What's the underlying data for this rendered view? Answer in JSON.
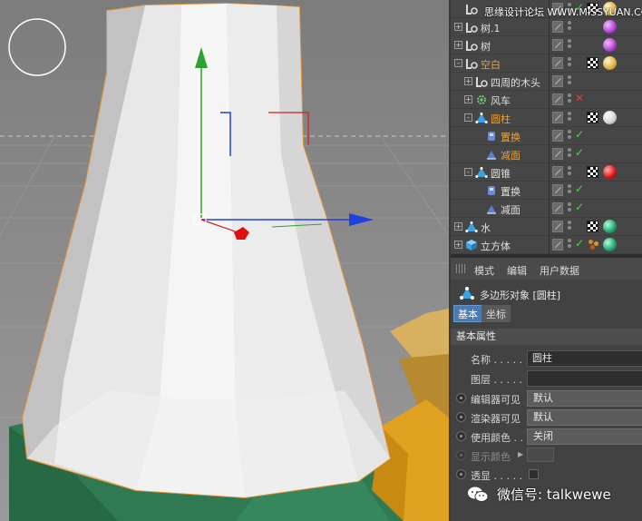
{
  "object_tree": [
    {
      "label": "",
      "icon": "null-object-icon",
      "indent": 0,
      "expand": "",
      "label_color": "normal",
      "state": "ok",
      "tag": "sphere-yellow"
    },
    {
      "label": "树.1",
      "icon": "null-object-icon",
      "indent": 0,
      "expand": "+",
      "label_color": "normal",
      "state": "",
      "tag": "sphere-purple"
    },
    {
      "label": "树",
      "icon": "null-object-icon",
      "indent": 0,
      "expand": "+",
      "label_color": "normal",
      "state": "",
      "tag": "sphere-purple"
    },
    {
      "label": "空白",
      "icon": "null-object-icon",
      "indent": 0,
      "expand": "-",
      "label_color": "orange",
      "state": "",
      "tag": "sphere-yellow"
    },
    {
      "label": "四周的木头",
      "icon": "null-object-icon",
      "indent": 1,
      "expand": "+",
      "label_color": "normal",
      "state": "",
      "tag": ""
    },
    {
      "label": "风车",
      "icon": "gear-icon",
      "indent": 1,
      "expand": "+",
      "label_color": "normal",
      "state": "x",
      "tag": ""
    },
    {
      "label": "圆柱",
      "icon": "polygon-icon",
      "indent": 1,
      "expand": "-",
      "label_color": "orange",
      "state": "",
      "tag": "sphere-white"
    },
    {
      "label": "置换",
      "icon": "displace-icon",
      "indent": 2,
      "expand": "",
      "label_color": "orange",
      "state": "ok",
      "tag": ""
    },
    {
      "label": "减面",
      "icon": "reduce-icon",
      "indent": 2,
      "expand": "",
      "label_color": "orange",
      "state": "ok",
      "tag": ""
    },
    {
      "label": "圆锥",
      "icon": "polygon-icon",
      "indent": 1,
      "expand": "-",
      "label_color": "normal",
      "state": "",
      "tag": "sphere-red"
    },
    {
      "label": "置换",
      "icon": "displace-icon",
      "indent": 2,
      "expand": "",
      "label_color": "normal",
      "state": "ok",
      "tag": ""
    },
    {
      "label": "减面",
      "icon": "reduce-icon",
      "indent": 2,
      "expand": "",
      "label_color": "normal",
      "state": "ok",
      "tag": ""
    },
    {
      "label": "水",
      "icon": "polygon-icon",
      "indent": 0,
      "expand": "+",
      "label_color": "normal",
      "state": "",
      "tag": "sphere-green"
    },
    {
      "label": "立方体",
      "icon": "cube-icon",
      "indent": 0,
      "expand": "+",
      "label_color": "normal",
      "state": "ok",
      "tag": "multi-green"
    }
  ],
  "attributes": {
    "menu": [
      "模式",
      "编辑",
      "用户数据"
    ],
    "object_title": "多边形对象 [圆柱]",
    "tabs": [
      "基本",
      "坐标"
    ],
    "section": "基本属性",
    "props": {
      "name_label": "名称 . . . . .",
      "name_value": "圆柱",
      "layer_label": "图层 . . . . .",
      "layer_value": "",
      "editor_visible_label": "编辑器可见",
      "editor_visible_value": "默认",
      "render_visible_label": "渲染器可见",
      "render_visible_value": "默认",
      "use_color_label": "使用颜色 . .",
      "use_color_value": "关闭",
      "display_color_label": "显示颜色",
      "xray_label": "透显 . . . . ."
    }
  },
  "watermarks": {
    "top": "思缘设计论坛 WWW.MISSYUAN.COM",
    "bottom": "微信号: talkwewe"
  },
  "colors": {
    "accent_tab": "#4b7bb0",
    "label_orange": "#f0a030",
    "check_green": "#4fd04f",
    "x_red": "#e04040",
    "axis_y_green": "#30a030",
    "axis_x_blue": "#2040e0"
  }
}
